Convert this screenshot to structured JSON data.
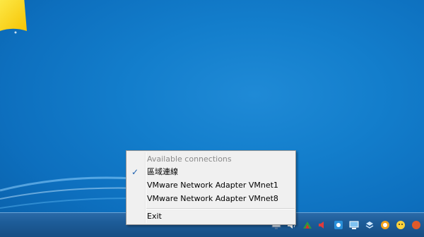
{
  "menu": {
    "header": "Available connections",
    "items": [
      {
        "label": "區域連線",
        "checked": true
      },
      {
        "label": "VMware Network Adapter VMnet1",
        "checked": false
      },
      {
        "label": "VMware Network Adapter VMnet8",
        "checked": false
      }
    ],
    "exit_label": "Exit",
    "check_glyph": "✓"
  },
  "tray": {
    "icons": [
      "network-icon",
      "volume-icon",
      "tool-icon",
      "speaker-muted-icon",
      "sync-icon",
      "display-icon",
      "dropbox-icon",
      "record-icon",
      "emoji-icon",
      "app-icon"
    ]
  },
  "colors": {
    "desktop": "#137ecc",
    "taskbar": "#1d5c98",
    "menu_background": "#f0f0f0",
    "check": "#1c5fae"
  }
}
